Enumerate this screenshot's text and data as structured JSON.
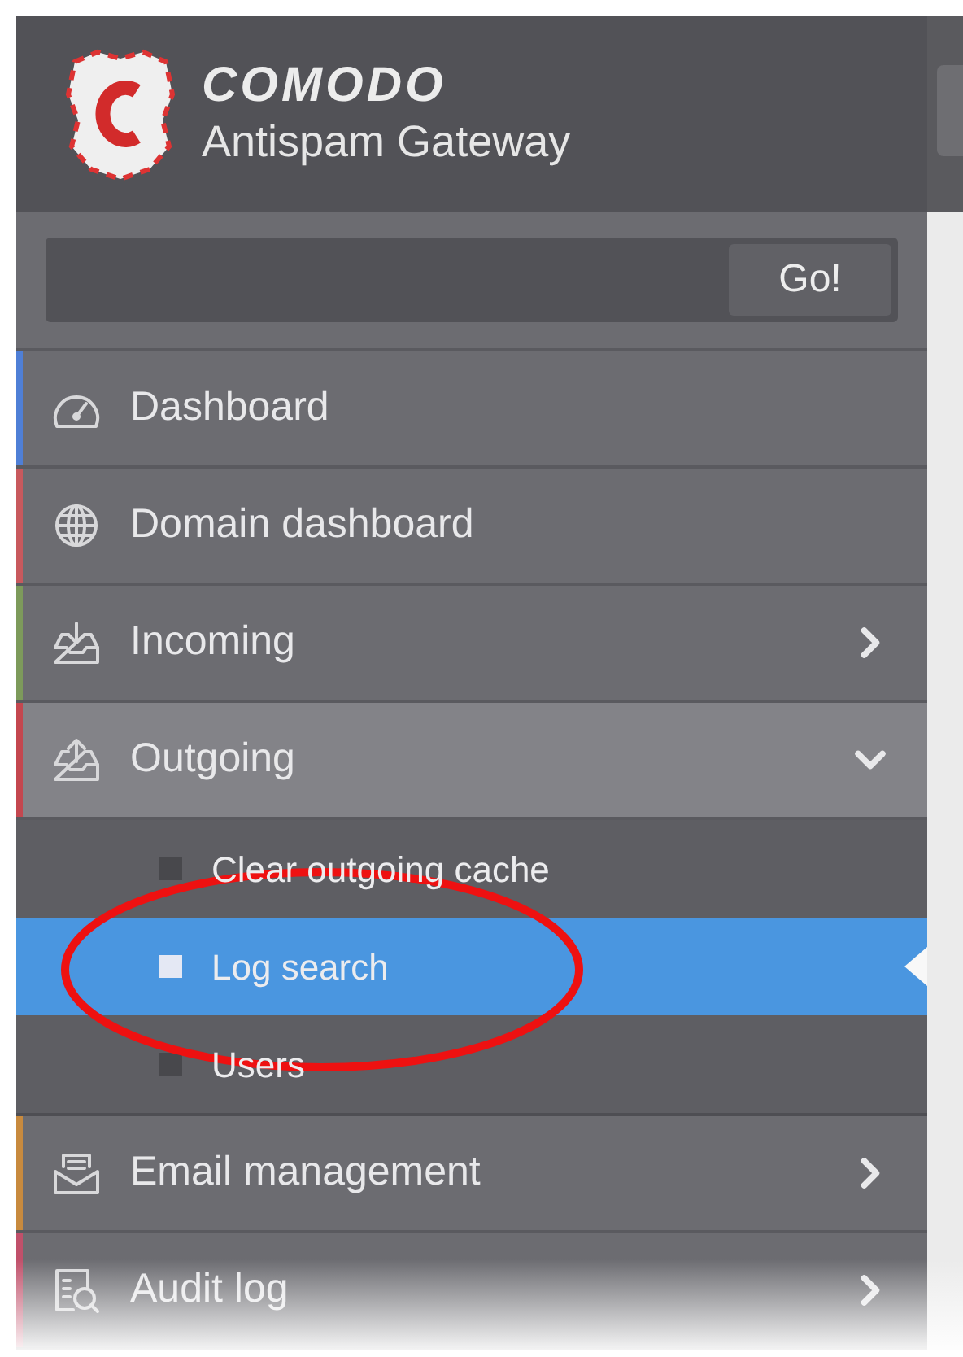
{
  "brand": {
    "name": "COMODO",
    "product": "Antispam Gateway"
  },
  "search": {
    "button": "Go!"
  },
  "menu": [
    {
      "kind": "link",
      "label": "Dashboard",
      "color": "#4f7fd6"
    },
    {
      "kind": "link",
      "label": "Domain dashboard",
      "color": "#c8595d"
    },
    {
      "kind": "group",
      "label": "Incoming",
      "color": "#7d9a5b",
      "expanded": false
    },
    {
      "kind": "group",
      "label": "Outgoing",
      "color": "#c4474f",
      "expanded": true,
      "children": [
        {
          "label": "Clear outgoing cache",
          "selected": false
        },
        {
          "label": "Log search",
          "selected": true
        },
        {
          "label": "Users",
          "selected": false
        }
      ]
    },
    {
      "kind": "group",
      "label": "Email management",
      "color": "#c88a3e",
      "expanded": false
    },
    {
      "kind": "group",
      "label": "Audit log",
      "color": "#c0506a",
      "expanded": false
    }
  ]
}
